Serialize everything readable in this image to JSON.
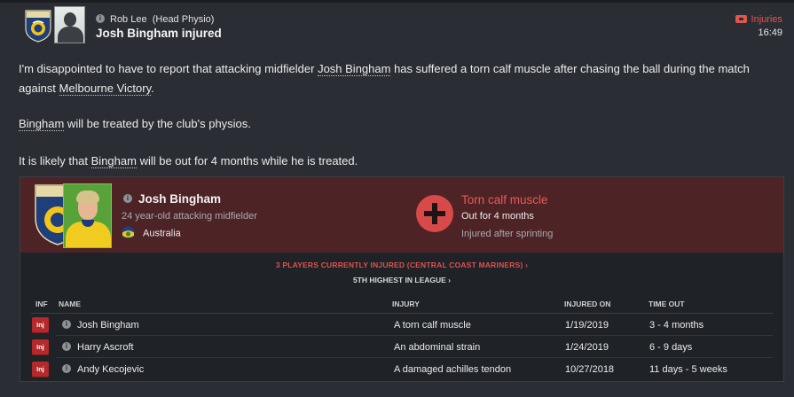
{
  "header": {
    "sender": "Rob Lee",
    "sender_role": "(Head Physio)",
    "title": "Josh Bingham injured",
    "category": "Injuries",
    "time": "16:49"
  },
  "body": {
    "p1_a": "I'm disappointed to have to report that attacking midfielder ",
    "p1_player": "Josh Bingham",
    "p1_b": " has suffered a torn calf muscle after chasing the ball during the match against ",
    "p1_opponent": "Melbourne Victory",
    "p1_c": ".",
    "p2_player": "Bingham",
    "p2_rest": " will be treated by the club's physios.",
    "p3_a": "It is likely that ",
    "p3_player": "Bingham",
    "p3_b": " will be out for 4 months while he is treated."
  },
  "player_card": {
    "name": "Josh Bingham",
    "description": "24 year-old attacking midfielder",
    "nation": "Australia"
  },
  "injury_card": {
    "title": "Torn calf muscle",
    "out_for": "Out for 4 months",
    "cause": "Injured after sprinting"
  },
  "summary": {
    "injured_link": "3 PLAYERS CURRENTLY INJURED (CENTRAL COAST MARINERS) ›",
    "league_link": "5TH HIGHEST IN LEAGUE ›"
  },
  "table": {
    "headers": {
      "inf": "INF",
      "name": "NAME",
      "injury": "INJURY",
      "injured_on": "INJURED ON",
      "time_out": "TIME OUT"
    },
    "rows": [
      {
        "badge": "Inj",
        "name": "Josh Bingham",
        "injury": "A torn calf muscle",
        "injured_on": "1/19/2019",
        "time_out": "3 - 4 months"
      },
      {
        "badge": "Inj",
        "name": "Harry Ascroft",
        "injury": "An abdominal strain",
        "injured_on": "1/24/2019",
        "time_out": "6 - 9 days"
      },
      {
        "badge": "Inj",
        "name": "Andy Kecojevic",
        "injury": "A damaged achilles tendon",
        "injured_on": "10/27/2018",
        "time_out": "11 days - 5 weeks"
      }
    ]
  },
  "icons": {
    "club_badge": "club-crest-icon",
    "info": "info-icon",
    "injury": "red-cross-icon",
    "flag": "australia-flag-icon",
    "tag": "tag-icon"
  },
  "colors": {
    "accent_red": "#e0564f",
    "panel_top": "#4e2326",
    "background": "#2a2d33"
  }
}
